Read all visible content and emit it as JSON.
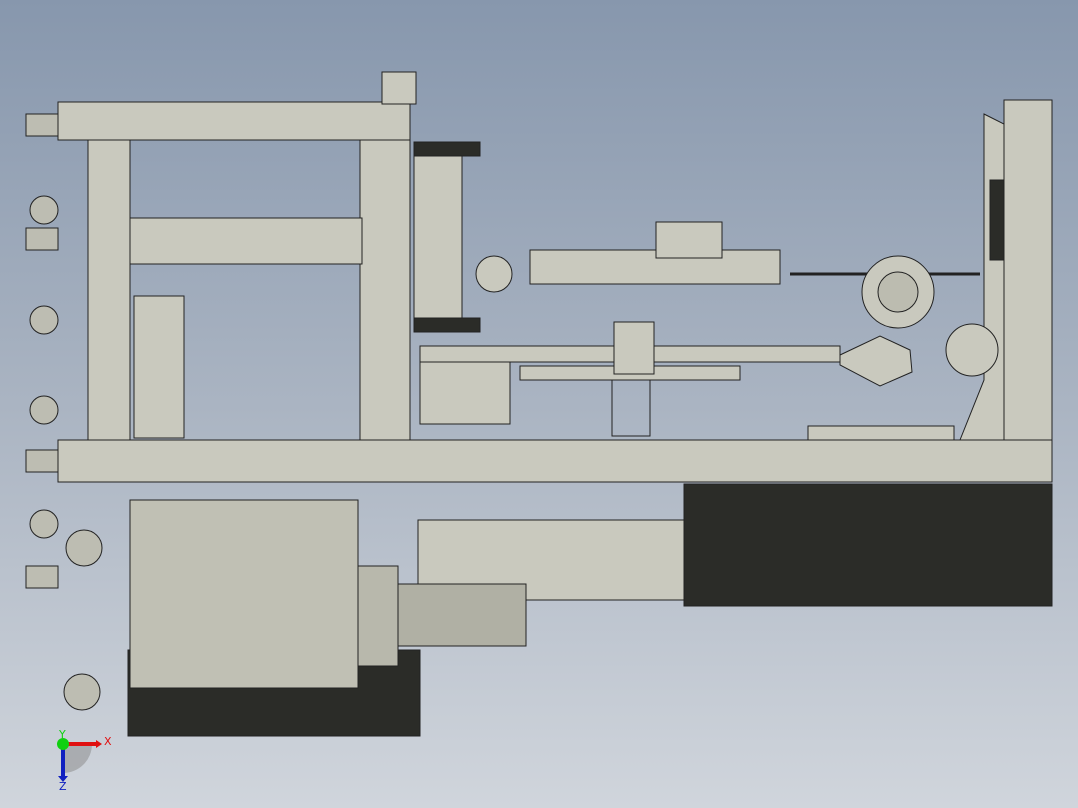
{
  "viewport": {
    "background_top": "#8797ad",
    "background_bottom": "#d0d5dc"
  },
  "model": {
    "frame_color": "#c8c8bc",
    "frame_edge_color": "#2a2a2a",
    "dark_panel_color": "#2b2c28"
  },
  "triad": {
    "x_label": "X",
    "y_label": "Y",
    "z_label": "Z",
    "x_color": "#e01010",
    "y_color": "#10d010",
    "z_color": "#1020c0"
  }
}
